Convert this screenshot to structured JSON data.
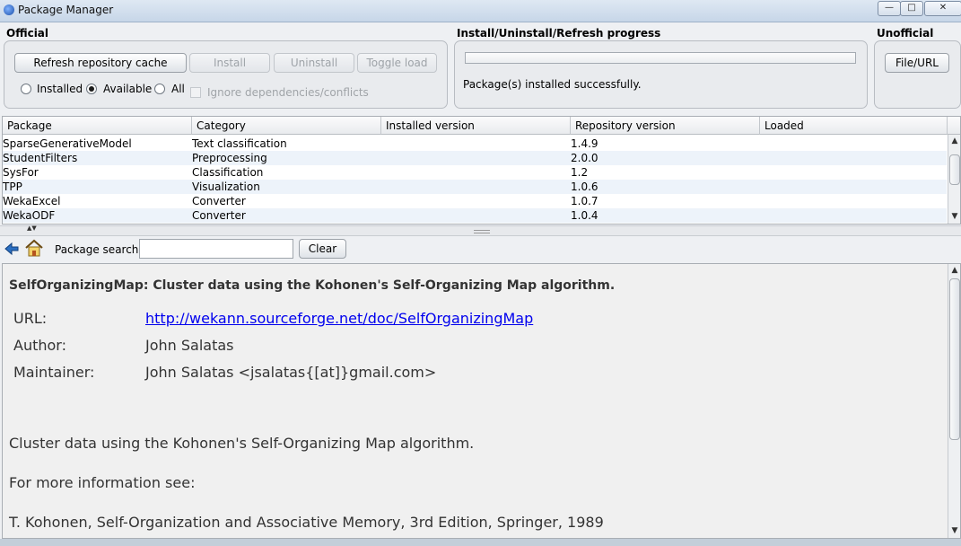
{
  "window": {
    "title": "Package Manager",
    "controls": {
      "minimize": "—",
      "maximize": "□",
      "close": "✕"
    }
  },
  "official": {
    "title": "Official",
    "refresh_label": "Refresh repository cache",
    "install_label": "Install",
    "uninstall_label": "Uninstall",
    "toggle_load_label": "Toggle load",
    "filters": {
      "installed": "Installed",
      "available": "Available",
      "all": "All",
      "selected": "Available"
    },
    "ignore_deps_label": "Ignore dependencies/conflicts",
    "ignore_deps_checked": false
  },
  "progress": {
    "title": "Install/Uninstall/Refresh progress",
    "status": "Package(s) installed successfully.",
    "fraction": 0
  },
  "unofficial": {
    "title": "Unofficial",
    "file_url_label": "File/URL"
  },
  "table": {
    "columns": [
      "Package",
      "Category",
      "Installed version",
      "Repository version",
      "Loaded"
    ],
    "rows": [
      [
        "SparseGenerativeModel",
        "Text classification",
        "",
        "1.4.9",
        ""
      ],
      [
        "StudentFilters",
        "Preprocessing",
        "",
        "2.0.0",
        ""
      ],
      [
        "SysFor",
        "Classification",
        "",
        "1.2",
        ""
      ],
      [
        "TPP",
        "Visualization",
        "",
        "1.0.6",
        ""
      ],
      [
        "WekaExcel",
        "Converter",
        "",
        "1.0.7",
        ""
      ],
      [
        "WekaODF",
        "Converter",
        "",
        "1.0.4",
        ""
      ]
    ]
  },
  "search": {
    "label": "Package search",
    "value": "",
    "clear_label": "Clear"
  },
  "info": {
    "heading": "SelfOrganizingMap: Cluster data using the Kohonen's Self-Organizing Map algorithm.",
    "url_key": "URL:",
    "url_value": "http://wekann.sourceforge.net/doc/SelfOrganizingMap",
    "author_key": "Author:",
    "author_value": "John Salatas",
    "maintainer_key": "Maintainer:",
    "maintainer_value": "John Salatas <jsalatas{[at]}gmail.com>",
    "description": "Cluster data using the Kohonen's Self-Organizing Map algorithm.",
    "more_info": "For more information see:",
    "reference": "T. Kohonen, Self-Organization and Associative Memory, 3rd Edition, Springer, 1989"
  }
}
